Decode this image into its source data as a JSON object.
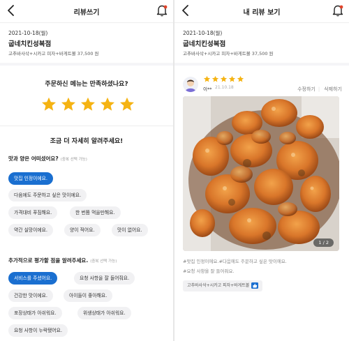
{
  "left": {
    "title": "리뷰쓰기",
    "order": {
      "date": "2021-10-18(월)",
      "store": "굽네치킨성복점",
      "menu": "고추바사삭+시카고 피자+바게트볼 37,500 원"
    },
    "question1": "주문하신 메뉴는 만족하셨나요?",
    "rating": 5,
    "question2": "조금 더 자세히 알려주세요!",
    "taste_section": {
      "label": "맛과 양은 어떠셨어요?",
      "hint": "(중복 선택 가능)",
      "chips": [
        {
          "text": "맛집 인정이에요.",
          "selected": true
        },
        {
          "text": "다음에도 주문하고 싶은 맛이에요.",
          "selected": false
        },
        {
          "text": "가격대비 푸짐해요.",
          "selected": false
        },
        {
          "text": "한 번쯤 먹을만해요.",
          "selected": false
        },
        {
          "text": "약간 실망이에요.",
          "selected": false
        },
        {
          "text": "양이 적어요.",
          "selected": false
        },
        {
          "text": "맛이 없어요.",
          "selected": false
        }
      ]
    },
    "extra_section": {
      "label": "추가적으로 평가할 점을 알려주세요.",
      "hint": "(중복 선택 가능)",
      "chips": [
        {
          "text": "서비스를 주셨어요.",
          "selected": true
        },
        {
          "text": "요청 사항을 잘 들어줘요.",
          "selected": false
        },
        {
          "text": "건강한 맛이에요.",
          "selected": false
        },
        {
          "text": "아이들이 좋아해요.",
          "selected": false
        },
        {
          "text": "포장상태가 아쉬워요.",
          "selected": false
        },
        {
          "text": "위생상태가 아쉬워요.",
          "selected": false
        },
        {
          "text": "요청 사항이 누락됐어요.",
          "selected": false
        }
      ]
    }
  },
  "right": {
    "title": "내 리뷰 보기",
    "order": {
      "date": "2021-10-18(월)",
      "store": "굽네치킨성복점",
      "menu": "고추바사삭+시카고 피자+바게트볼 37,500 원"
    },
    "review": {
      "rating": 5,
      "user": "이**",
      "date": "21.10.18",
      "edit_label": "수정하기",
      "delete_label": "삭제하기",
      "pager": "1 / 2",
      "tags_line1": "#맛집 인정이에요.#다음에도 주문하고 싶은 맛이에요.",
      "tags_line2": "#요청 사항을 잘 들어줘요.",
      "menu_chip": "고추바사삭+시카고 피자+바게트볼"
    }
  },
  "colors": {
    "accent": "#1a6fd0",
    "star": "#f5b312",
    "chip_bg": "#f1f1f3",
    "bell": "#e0442b"
  },
  "icons": [
    "back-arrow-icon",
    "bell-icon",
    "star-icon",
    "avatar-icon",
    "thumbs-up-icon"
  ]
}
